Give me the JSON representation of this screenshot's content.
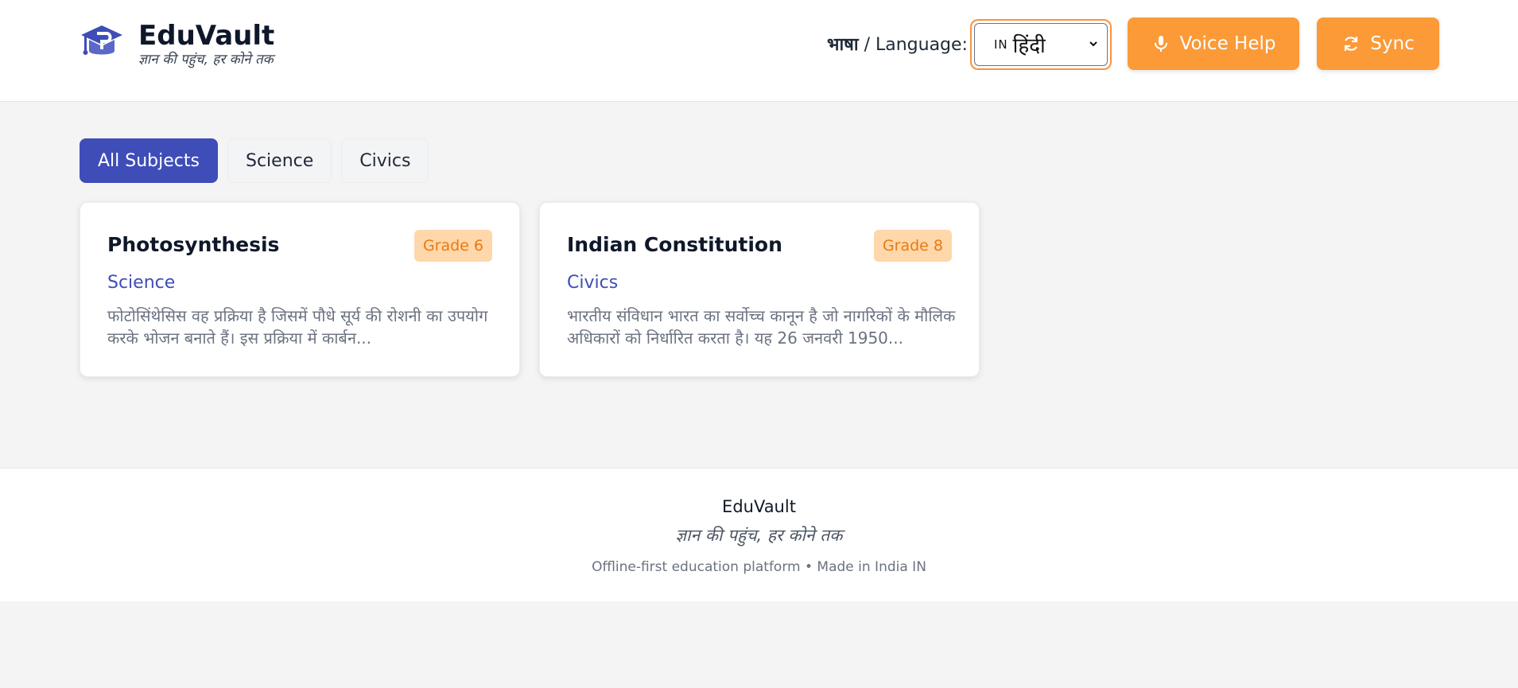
{
  "header": {
    "brand": "EduVault",
    "tagline": "ज्ञान की पहुंच, हर कोने तक",
    "language_label_hindi": "भाषा",
    "language_label_sep": " / Language:",
    "language_select": {
      "flag": "IN",
      "value": "हिंदी"
    },
    "voice_help_label": "Voice Help",
    "sync_label": "Sync"
  },
  "tabs": [
    {
      "label": "All Subjects",
      "active": true
    },
    {
      "label": "Science",
      "active": false
    },
    {
      "label": "Civics",
      "active": false
    }
  ],
  "cards": [
    {
      "title": "Photosynthesis",
      "grade": "Grade 6",
      "subject": "Science",
      "description": "फोटोसिंथेसिस वह प्रक्रिया है जिसमें पौधे सूर्य की रोशनी का उपयोग करके भोजन बनाते हैं। इस प्रक्रिया में कार्बन..."
    },
    {
      "title": "Indian Constitution",
      "grade": "Grade 8",
      "subject": "Civics",
      "description": "भारतीय संविधान भारत का सर्वोच्च कानून है जो नागरिकों के मौलिक अधिकारों को निर्धारित करता है। यह 26 जनवरी 1950..."
    }
  ],
  "footer": {
    "brand": "EduVault",
    "tagline": "ज्ञान की पहुंच, हर कोने तक",
    "note": "Offline-first education platform • Made in India IN"
  },
  "icons": {
    "logo": "graduation-cap-icon",
    "voice": "microphone-icon",
    "sync": "sync-icon",
    "select": "chevron-down-icon"
  },
  "colors": {
    "primary": "#3f4db8",
    "accent": "#fb9a37",
    "badge_bg": "#fed7aa",
    "badge_text": "#ea7a10"
  }
}
